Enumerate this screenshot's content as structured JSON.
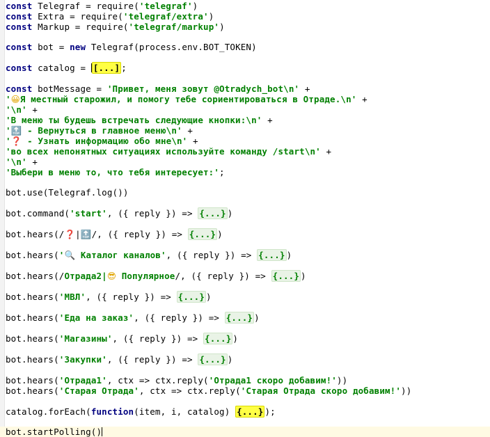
{
  "editor": {
    "lines": [
      {
        "id": 1,
        "segments": [
          {
            "k": "kw",
            "t": "const"
          },
          {
            "k": "p",
            "t": " Telegraf = require("
          },
          {
            "k": "str",
            "t": "'telegraf'"
          },
          {
            "k": "p",
            "t": ")"
          }
        ]
      },
      {
        "id": 2,
        "segments": [
          {
            "k": "kw",
            "t": "const"
          },
          {
            "k": "p",
            "t": " Extra = require("
          },
          {
            "k": "str",
            "t": "'telegraf/extra'"
          },
          {
            "k": "p",
            "t": ")"
          }
        ]
      },
      {
        "id": 3,
        "segments": [
          {
            "k": "kw",
            "t": "const"
          },
          {
            "k": "p",
            "t": " Markup = require("
          },
          {
            "k": "str",
            "t": "'telegraf/markup'"
          },
          {
            "k": "p",
            "t": ")"
          }
        ]
      },
      {
        "id": 4,
        "segments": []
      },
      {
        "id": 5,
        "segments": [
          {
            "k": "kw",
            "t": "const"
          },
          {
            "k": "p",
            "t": " bot = "
          },
          {
            "k": "kw",
            "t": "new"
          },
          {
            "k": "p",
            "t": " Telegraf(process.env.BOT_TOKEN)"
          }
        ]
      },
      {
        "id": 6,
        "segments": []
      },
      {
        "id": 7,
        "segments": [
          {
            "k": "kw",
            "t": "const"
          },
          {
            "k": "p",
            "t": " catalog = "
          },
          {
            "k": "caret",
            "t": ""
          },
          {
            "k": "fold-hl",
            "t": "[...]"
          },
          {
            "k": "p",
            "t": ";"
          }
        ]
      },
      {
        "id": 8,
        "segments": []
      },
      {
        "id": 9,
        "segments": [
          {
            "k": "kw",
            "t": "const"
          },
          {
            "k": "p",
            "t": " botMessage = "
          },
          {
            "k": "str",
            "t": "'Привет, меня зовут @Otradych_bot\\n'"
          },
          {
            "k": "p",
            "t": " +"
          }
        ]
      },
      {
        "id": 10,
        "segments": [
          {
            "k": "str",
            "t": "'"
          },
          {
            "k": "emoji-face",
            "t": "😀"
          },
          {
            "k": "str",
            "t": "Я местный старожил, и помогу тебе сориентироваться в Отраде.\\n'"
          },
          {
            "k": "p",
            "t": " +"
          }
        ]
      },
      {
        "id": 11,
        "segments": [
          {
            "k": "str",
            "t": "'\\n'"
          },
          {
            "k": "p",
            "t": " +"
          }
        ]
      },
      {
        "id": 12,
        "segments": [
          {
            "k": "str",
            "t": "'В меню ты будешь встречать следующие кнопки:\\n'"
          },
          {
            "k": "p",
            "t": " +"
          }
        ]
      },
      {
        "id": 13,
        "segments": [
          {
            "k": "str",
            "t": "'"
          },
          {
            "k": "emoji-dark",
            "t": "🔝"
          },
          {
            "k": "str",
            "t": " - Вернуться в главное меню\\n'"
          },
          {
            "k": "p",
            "t": " +"
          }
        ]
      },
      {
        "id": 14,
        "segments": [
          {
            "k": "str",
            "t": "'"
          },
          {
            "k": "emoji-red",
            "t": "❓"
          },
          {
            "k": "str",
            "t": " - Узнать информацию обо мне\\n'"
          },
          {
            "k": "p",
            "t": " +"
          }
        ]
      },
      {
        "id": 15,
        "segments": [
          {
            "k": "str",
            "t": "'во всех непонятных ситуациях используйте команду /start\\n'"
          },
          {
            "k": "p",
            "t": " +"
          }
        ]
      },
      {
        "id": 16,
        "segments": [
          {
            "k": "str",
            "t": "'\\n'"
          },
          {
            "k": "p",
            "t": " +"
          }
        ]
      },
      {
        "id": 17,
        "segments": [
          {
            "k": "str",
            "t": "'Выбери в меню то, что тебя интересует:'"
          },
          {
            "k": "p",
            "t": ";"
          }
        ]
      },
      {
        "id": 18,
        "segments": []
      },
      {
        "id": 19,
        "segments": [
          {
            "k": "p",
            "t": "bot.use(Telegraf.log())"
          }
        ]
      },
      {
        "id": 20,
        "segments": []
      },
      {
        "id": 21,
        "segments": [
          {
            "k": "p",
            "t": "bot.command("
          },
          {
            "k": "str",
            "t": "'start'"
          },
          {
            "k": "p",
            "t": ", ({ reply }) => "
          },
          {
            "k": "fold",
            "t": "{...}"
          },
          {
            "k": "p",
            "t": ")"
          }
        ]
      },
      {
        "id": 22,
        "segments": []
      },
      {
        "id": 23,
        "segments": [
          {
            "k": "p",
            "t": "bot.hears(/"
          },
          {
            "k": "emoji-red",
            "t": "❓"
          },
          {
            "k": "p",
            "t": "|"
          },
          {
            "k": "emoji-dark",
            "t": "🔝"
          },
          {
            "k": "p",
            "t": "/, ({ reply }) => "
          },
          {
            "k": "fold",
            "t": "{...}"
          },
          {
            "k": "p",
            "t": ")"
          }
        ]
      },
      {
        "id": 24,
        "segments": []
      },
      {
        "id": 25,
        "segments": [
          {
            "k": "p",
            "t": "bot.hears("
          },
          {
            "k": "str",
            "t": "'"
          },
          {
            "k": "emoji-dark",
            "t": "🔍"
          },
          {
            "k": "str",
            "t": " Каталог каналов'"
          },
          {
            "k": "p",
            "t": ", ({ reply }) => "
          },
          {
            "k": "fold",
            "t": "{...}"
          },
          {
            "k": "p",
            "t": ")"
          }
        ]
      },
      {
        "id": 26,
        "segments": []
      },
      {
        "id": 27,
        "segments": [
          {
            "k": "p",
            "t": "bot.hears(/"
          },
          {
            "k": "str",
            "t": "Отрада2|"
          },
          {
            "k": "emoji-face",
            "t": "😎"
          },
          {
            "k": "str",
            "t": " Популярное"
          },
          {
            "k": "p",
            "t": "/, ({ reply }) => "
          },
          {
            "k": "fold",
            "t": "{...}"
          },
          {
            "k": "p",
            "t": ")"
          }
        ]
      },
      {
        "id": 28,
        "segments": []
      },
      {
        "id": 29,
        "segments": [
          {
            "k": "p",
            "t": "bot.hears("
          },
          {
            "k": "str",
            "t": "'МВЛ'"
          },
          {
            "k": "p",
            "t": ", ({ reply }) => "
          },
          {
            "k": "fold",
            "t": "{...}"
          },
          {
            "k": "p",
            "t": ")"
          }
        ]
      },
      {
        "id": 30,
        "segments": []
      },
      {
        "id": 31,
        "segments": [
          {
            "k": "p",
            "t": "bot.hears("
          },
          {
            "k": "str",
            "t": "'Еда на заказ'"
          },
          {
            "k": "p",
            "t": ", ({ reply }) => "
          },
          {
            "k": "fold",
            "t": "{...}"
          },
          {
            "k": "p",
            "t": ")"
          }
        ]
      },
      {
        "id": 32,
        "segments": []
      },
      {
        "id": 33,
        "segments": [
          {
            "k": "p",
            "t": "bot.hears("
          },
          {
            "k": "str",
            "t": "'Магазины'"
          },
          {
            "k": "p",
            "t": ", ({ reply }) => "
          },
          {
            "k": "fold",
            "t": "{...}"
          },
          {
            "k": "p",
            "t": ")"
          }
        ]
      },
      {
        "id": 34,
        "segments": []
      },
      {
        "id": 35,
        "segments": [
          {
            "k": "p",
            "t": "bot.hears("
          },
          {
            "k": "str",
            "t": "'Закупки'"
          },
          {
            "k": "p",
            "t": ", ({ reply }) => "
          },
          {
            "k": "fold",
            "t": "{...}"
          },
          {
            "k": "p",
            "t": ")"
          }
        ]
      },
      {
        "id": 36,
        "segments": []
      },
      {
        "id": 37,
        "segments": [
          {
            "k": "p",
            "t": "bot.hears("
          },
          {
            "k": "str",
            "t": "'Отрада1'"
          },
          {
            "k": "p",
            "t": ", ctx => ctx.reply("
          },
          {
            "k": "str",
            "t": "'Отрада1 скоро добавим!'"
          },
          {
            "k": "p",
            "t": "))"
          }
        ]
      },
      {
        "id": 38,
        "segments": [
          {
            "k": "p",
            "t": "bot.hears("
          },
          {
            "k": "str",
            "t": "'Старая Отрада'"
          },
          {
            "k": "p",
            "t": ", ctx => ctx.reply("
          },
          {
            "k": "str",
            "t": "'Старая Отрада скоро добавим!'"
          },
          {
            "k": "p",
            "t": "))"
          }
        ]
      },
      {
        "id": 39,
        "segments": []
      },
      {
        "id": 40,
        "segments": [
          {
            "k": "p",
            "t": "catalog.forEach("
          },
          {
            "k": "kw",
            "t": "function"
          },
          {
            "k": "p",
            "t": "(item, i, catalog) "
          },
          {
            "k": "fold-hl",
            "t": "{...}"
          },
          {
            "k": "p",
            "t": ");"
          }
        ]
      },
      {
        "id": 41,
        "segments": []
      },
      {
        "id": 42,
        "current": true,
        "segments": [
          {
            "k": "p",
            "t": "bot.startPolling()"
          },
          {
            "k": "caret",
            "t": ""
          }
        ]
      }
    ]
  }
}
